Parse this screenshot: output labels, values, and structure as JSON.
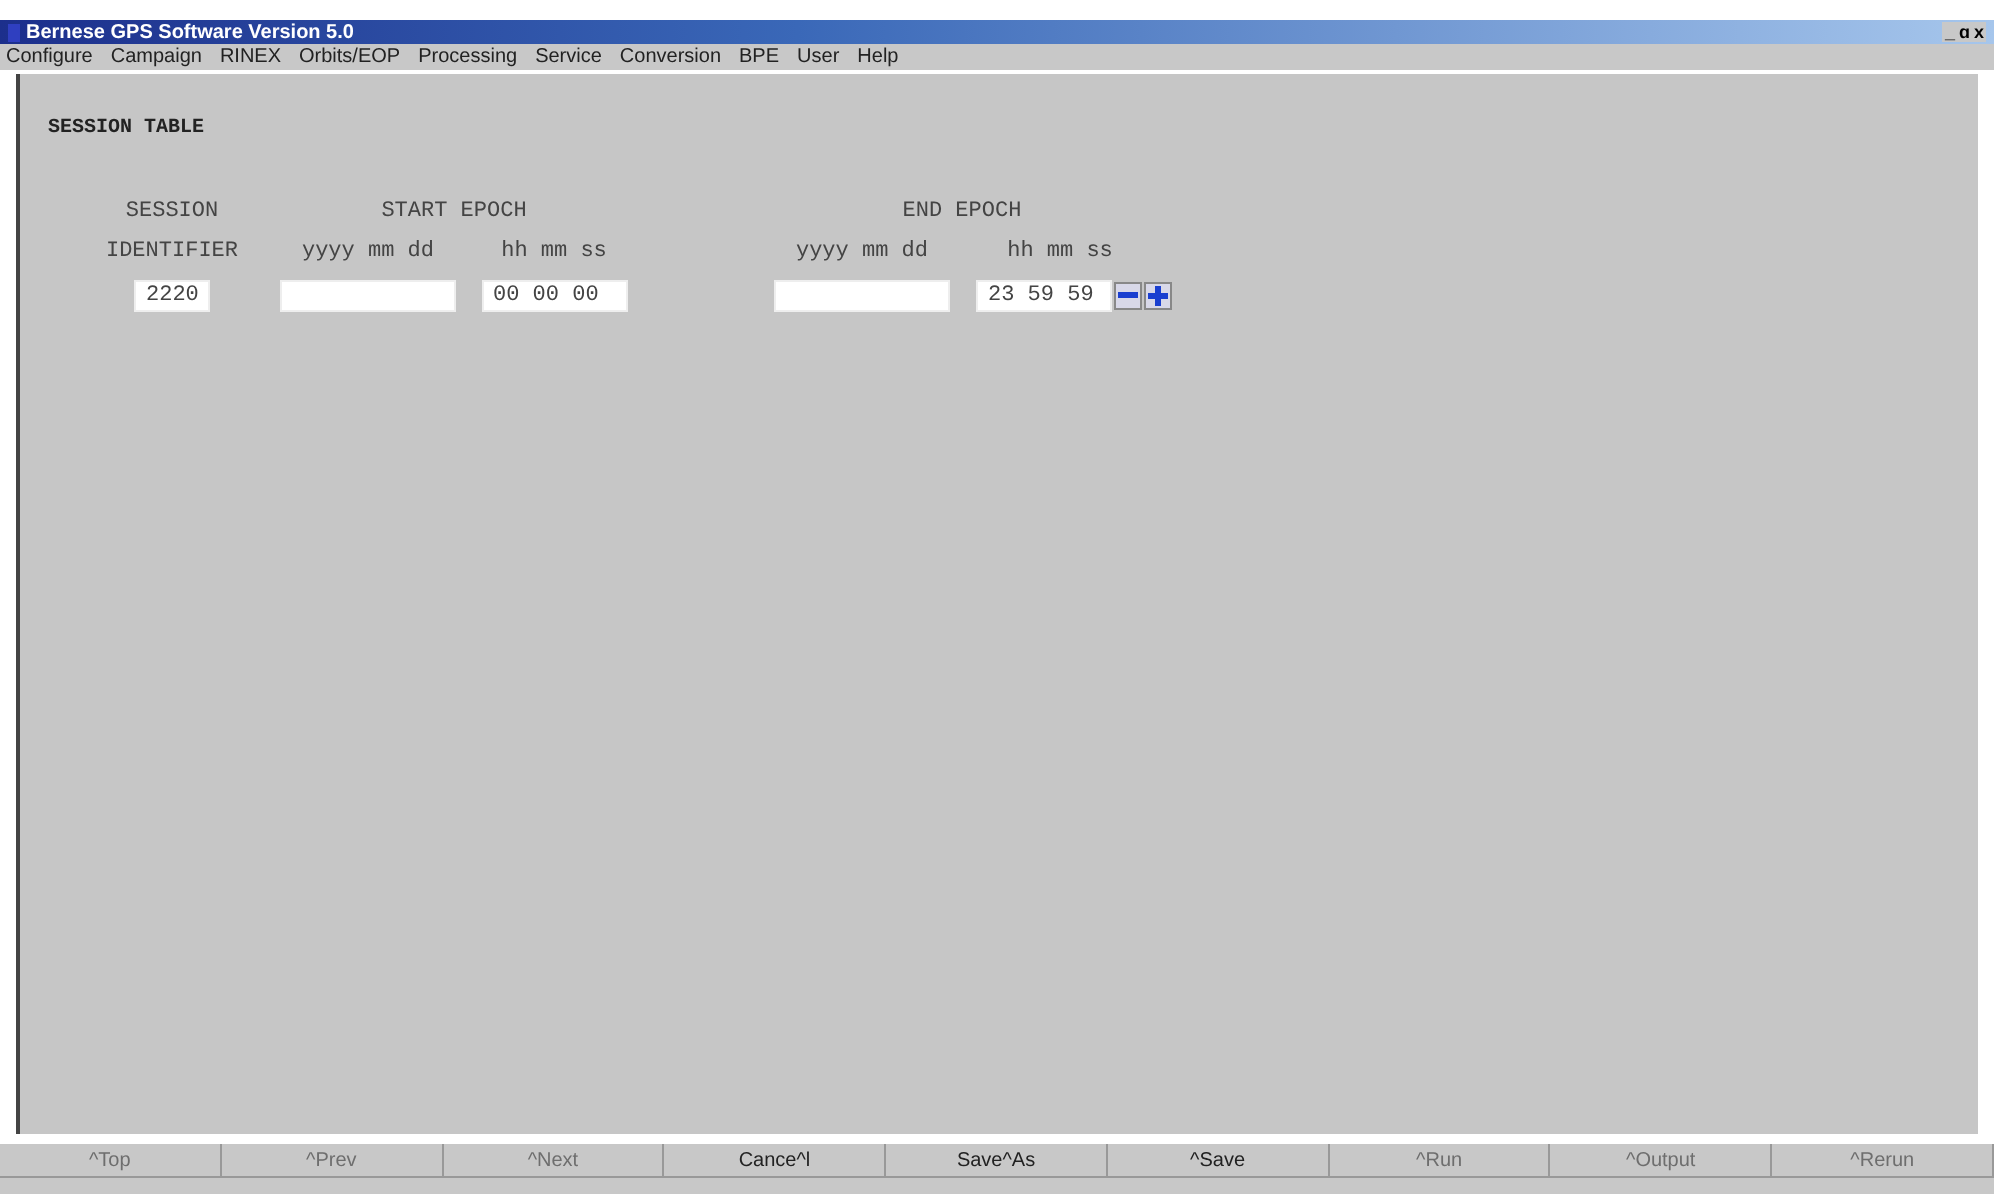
{
  "window": {
    "title": "Bernese GPS Software Version 5.0",
    "controls": [
      "_",
      "ɑ",
      "x"
    ]
  },
  "menu": [
    {
      "label": "Configure"
    },
    {
      "label": "Campaign"
    },
    {
      "label": "RINEX"
    },
    {
      "label": "Orbits/EOP"
    },
    {
      "label": "Processing"
    },
    {
      "label": "Service"
    },
    {
      "label": "Conversion"
    },
    {
      "label": "BPE"
    },
    {
      "label": "User"
    },
    {
      "label": "Help"
    }
  ],
  "panel": {
    "title": "SESSION TABLE",
    "headers": [
      {
        "line1": "SESSION",
        "line2": "IDENTIFIER"
      },
      {
        "line1": "START EPOCH",
        "date": "yyyy mm dd",
        "time": "hh mm ss"
      },
      {
        "line1": "END EPOCH",
        "date": "yyyy mm dd",
        "time": "hh mm ss"
      }
    ],
    "row": {
      "session": "2220",
      "start_time": "00 00 00",
      "end_time": "23 59 59"
    }
  },
  "buttons": [
    {
      "label": "^Top",
      "disabled": true
    },
    {
      "label": "^Prev",
      "disabled": true
    },
    {
      "label": "^Next",
      "disabled": true
    },
    {
      "label": "Cance^l",
      "disabled": false
    },
    {
      "label": "Save^As",
      "disabled": false
    },
    {
      "label": "^Save",
      "disabled": false
    },
    {
      "label": "^Run",
      "disabled": true
    },
    {
      "label": "^Output",
      "disabled": true
    },
    {
      "label": "^Rerun",
      "disabled": true
    }
  ]
}
